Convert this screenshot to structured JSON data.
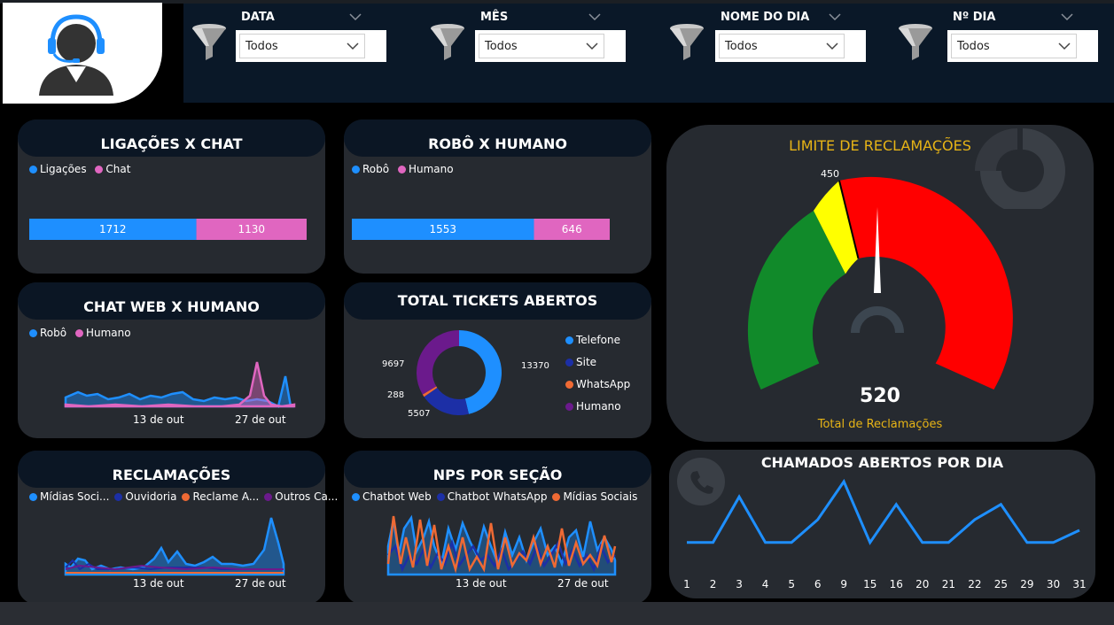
{
  "filters": [
    {
      "label": "DATA",
      "value": "Todos"
    },
    {
      "label": "MÊS",
      "value": "Todos"
    },
    {
      "label": "NOME DO DIA",
      "value": "Todos"
    },
    {
      "label": "Nº DIA",
      "value": "Todos"
    }
  ],
  "ligacoes": {
    "title": "LIGAÇÕES X CHAT",
    "legend": [
      "Ligações",
      "Chat"
    ],
    "values": [
      1712,
      1130
    ],
    "labels": [
      "1712",
      "1130"
    ]
  },
  "robo": {
    "title": "ROBÔ X HUMANO",
    "legend": [
      "Robô",
      "Humano"
    ],
    "values": [
      1553,
      646
    ],
    "labels": [
      "1553",
      "646"
    ]
  },
  "chatweb": {
    "title": "CHAT WEB X HUMANO",
    "legend": [
      "Robô",
      "Humano"
    ],
    "x1": "13 de out",
    "x2": "27 de out"
  },
  "tickets": {
    "title": "TOTAL TICKETS ABERTOS",
    "legend": [
      "Telefone",
      "Site",
      "WhatsApp",
      "Humano"
    ],
    "values": [
      13370,
      5507,
      288,
      9697
    ],
    "labels": [
      "13370",
      "5507",
      "288",
      "9697"
    ]
  },
  "reclamacoes": {
    "title": "RECLAMAÇÕES",
    "legend": [
      "Mídias Soci...",
      "Ouvidoria",
      "Reclame A...",
      "Outros  Ca..."
    ],
    "x1": "13 de out",
    "x2": "27 de out"
  },
  "nps": {
    "title": "NPS POR SEÇÃO",
    "legend": [
      "Chatbot Web",
      "Chatbot WhatsApp",
      "Mídias Sociais"
    ],
    "x1": "13 de out",
    "x2": "27 de out"
  },
  "gauge": {
    "title": "LIMITE DE RECLAMAÇÕES",
    "value": "520",
    "value_label": "Total de Reclamações",
    "mark": "450"
  },
  "chamados": {
    "title": "CHAMADOS ABERTOS POR DIA",
    "days": [
      "1",
      "2",
      "3",
      "4",
      "5",
      "6",
      "9",
      "15",
      "16",
      "20",
      "21",
      "22",
      "25",
      "29",
      "30",
      "31"
    ],
    "values": [
      1,
      1,
      4,
      1,
      1,
      2.5,
      5,
      1,
      3.5,
      1,
      1,
      2.5,
      3.5,
      1,
      1,
      1.8
    ]
  },
  "colors": {
    "blue": "#1e8fff",
    "pink": "#e066c0",
    "darkblue": "#1c2fa6",
    "orange": "#ef6a34",
    "purple": "#6b1a8c",
    "green": "#118a2a",
    "yellow": "#ffff00",
    "red": "#ff0000",
    "gold": "#e7b416"
  }
}
